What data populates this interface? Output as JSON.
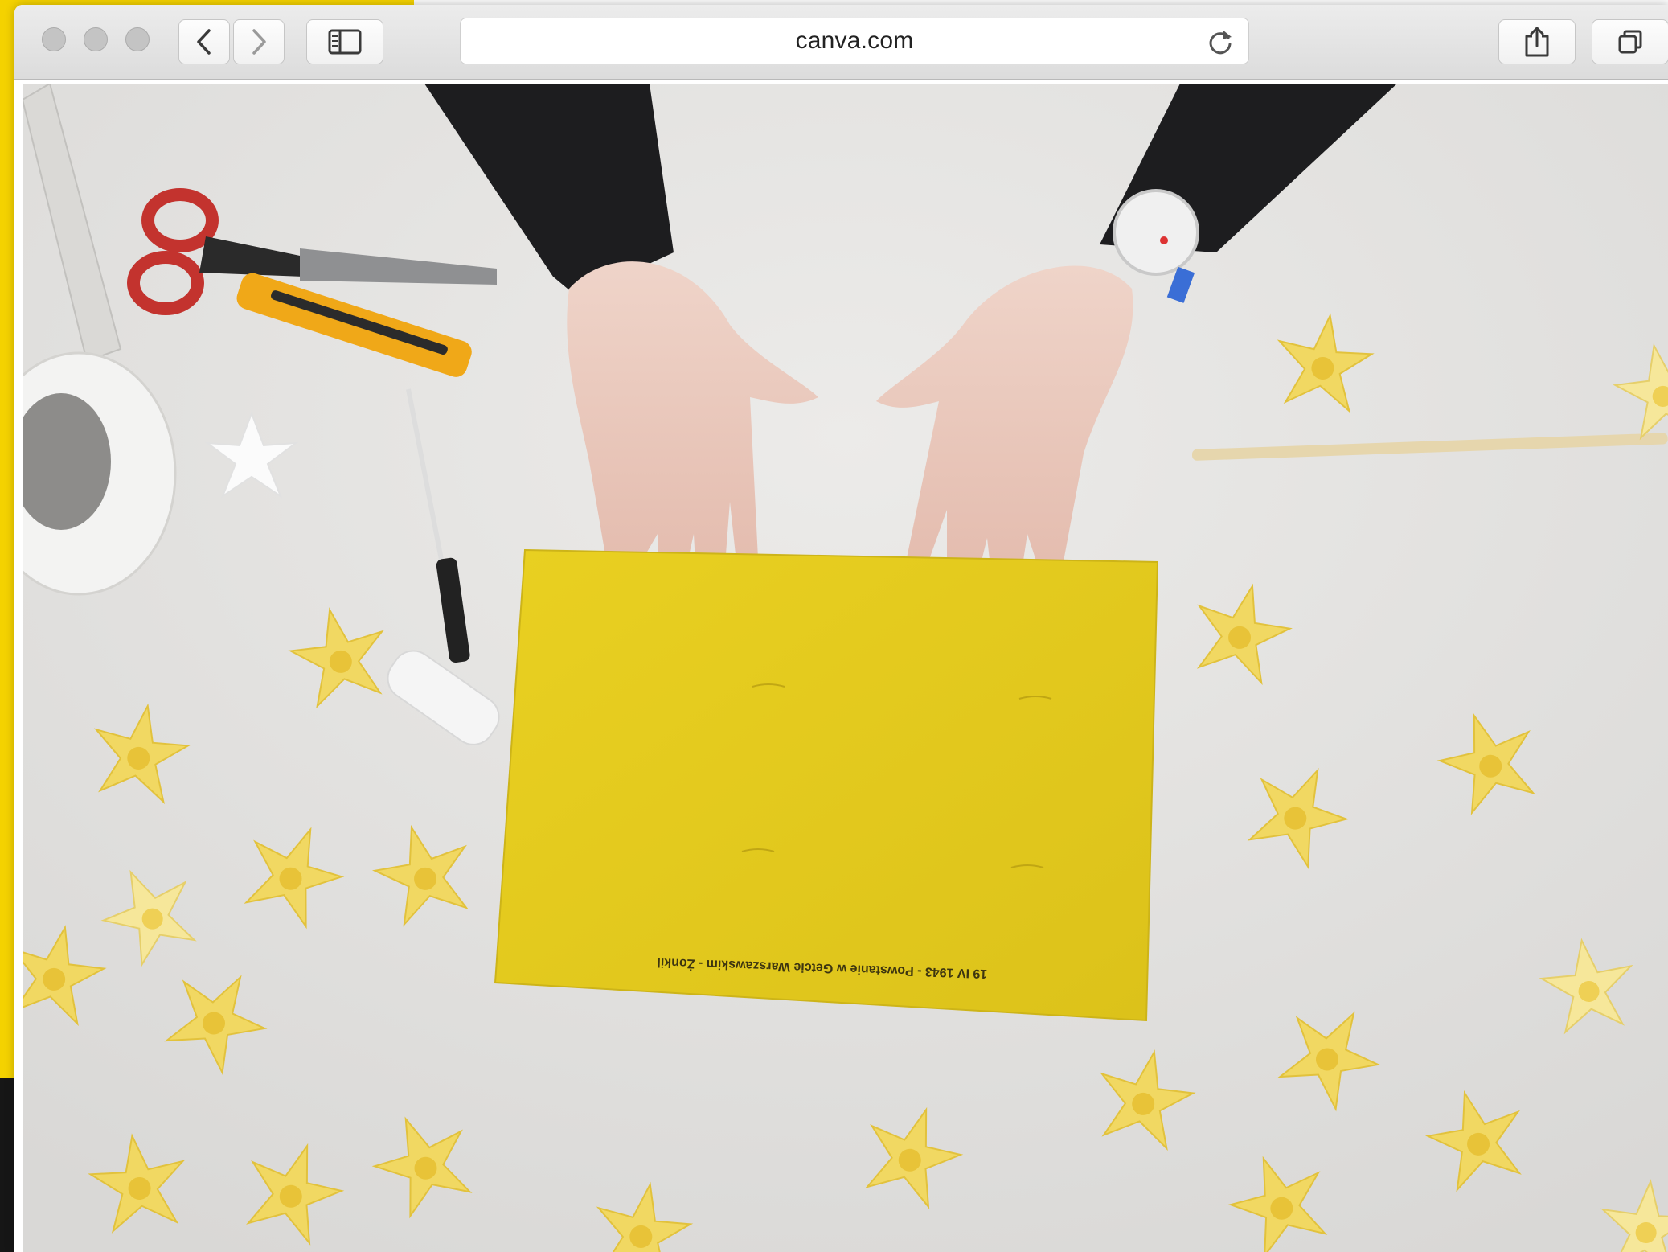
{
  "browser": {
    "url": "canva.com",
    "buttons": {
      "back": "back-icon",
      "forward": "forward-icon",
      "sidebar": "sidebar-icon",
      "reload": "reload-icon",
      "share": "share-icon",
      "tabs": "tabs-icon"
    }
  },
  "video_frame": {
    "paper_caption": "19 IV 1943 - Powstanie w Getcie Warszawskim - Żonkil",
    "colors": {
      "paper": "#e6cc1e",
      "daffodil": "#f3dc6a",
      "table": "#e7e7e5",
      "sleeves": "#1d1d1f"
    }
  }
}
